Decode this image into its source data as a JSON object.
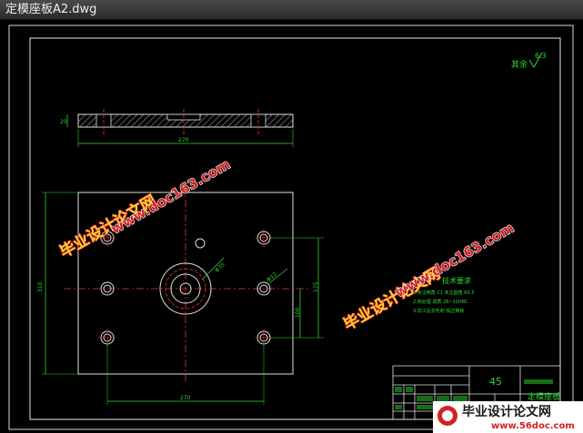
{
  "window": {
    "title": "定模座板A2.dwg"
  },
  "drawing": {
    "roughness_note": "其余",
    "roughness_value": "6.3",
    "tech_title": "技术要求",
    "tech_lines": [
      "1.未注倒角 C1 未注圆角 R0.5",
      "2.热处理 调质 28~32HRC",
      "3.加工后去毛刺 锐边倒钝"
    ],
    "material": "45",
    "part_name": "定模座板",
    "dims": {
      "top_height": "20",
      "top_width": "270",
      "left_height": "310",
      "right_v1": "175",
      "right_v2": "100",
      "bottom_width": "270",
      "dia_center": "Φ35",
      "dia_hole": "Φ12"
    }
  },
  "watermarks": {
    "cn": "毕业设计论文网",
    "url": "www.doc163.com",
    "logo_cn": "毕业设计论文网",
    "logo_url": "www.56doc.com"
  }
}
